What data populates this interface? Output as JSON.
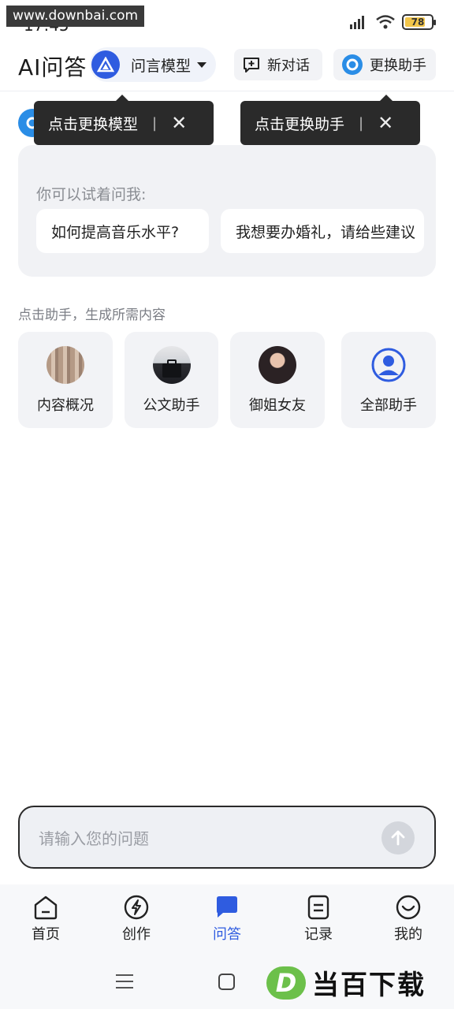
{
  "status_bar": {
    "watermark": "www.downbai.com",
    "time": "17:45",
    "battery": "78",
    "battery_level": 0.78
  },
  "header": {
    "title": "AI问答",
    "model_label": "问言模型",
    "new_chat_label": "新对话",
    "change_assistant_label": "更换助手"
  },
  "tooltips": {
    "model_tip": "点击更换模型",
    "assistant_tip": "点击更换助手",
    "separator": "|",
    "close": "✕"
  },
  "suggestions": {
    "title": "你可以试着问我:",
    "chips": [
      "如何提高音乐水平?",
      "我想要办婚礼，请给些建议"
    ]
  },
  "assistants": {
    "heading": "点击助手，生成所需内容",
    "items": [
      {
        "name": "内容概况",
        "icon": "content-avatar"
      },
      {
        "name": "公文助手",
        "icon": "document-avatar"
      },
      {
        "name": "御姐女友",
        "icon": "girlfriend-avatar"
      },
      {
        "name": "全部助手",
        "icon": "person-icon"
      }
    ]
  },
  "input": {
    "placeholder": "请输入您的问题"
  },
  "bottom_nav": {
    "items": [
      {
        "label": "首页",
        "icon": "home-icon"
      },
      {
        "label": "创作",
        "icon": "lightning-icon"
      },
      {
        "label": "问答",
        "icon": "chat-icon",
        "active": true
      },
      {
        "label": "记录",
        "icon": "record-icon"
      },
      {
        "label": "我的",
        "icon": "smile-icon"
      }
    ]
  },
  "watermark_logo": {
    "letter": "D",
    "text": "当百下载"
  },
  "colors": {
    "accent": "#2f5ce0",
    "tooltip_bg": "#2a2a2a",
    "card_bg": "#f1f2f5"
  }
}
